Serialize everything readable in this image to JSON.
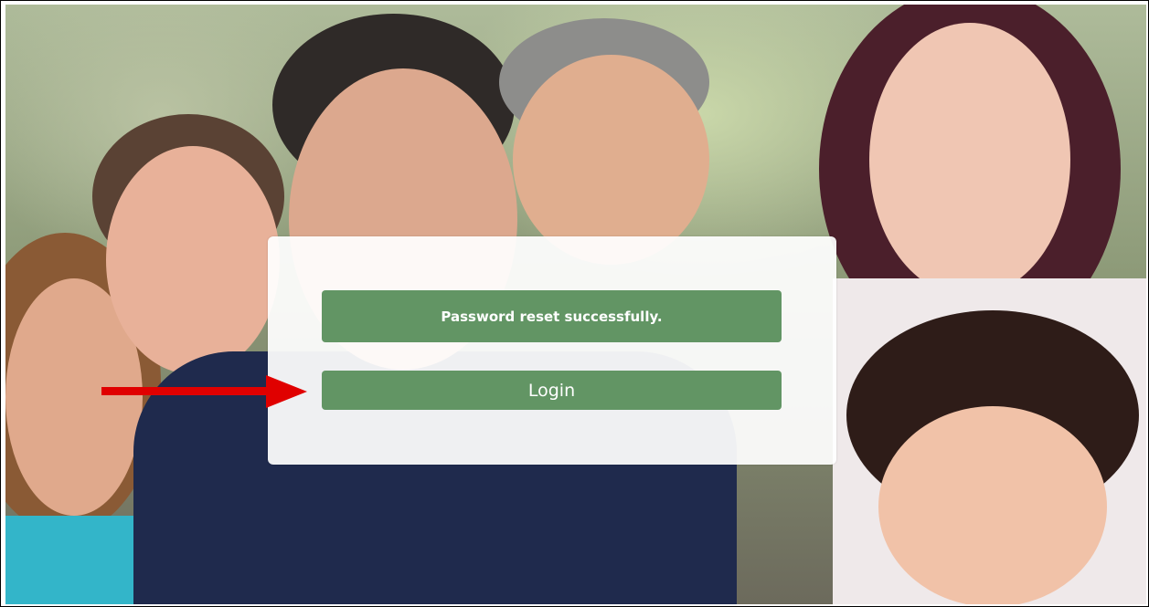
{
  "notice": {
    "message": "Password reset successfully."
  },
  "actions": {
    "login_label": "Login"
  },
  "colors": {
    "button_green": "#629564",
    "panel_white": "#ffffff",
    "annotation_arrow": "#e00000"
  },
  "annotation": {
    "icon": "arrow-right-icon"
  }
}
